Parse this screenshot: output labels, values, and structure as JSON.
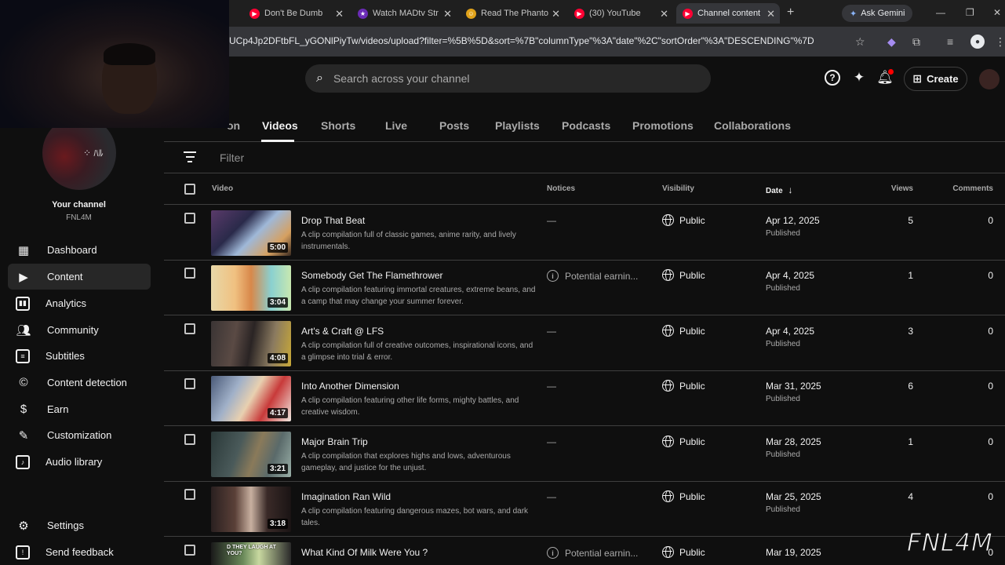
{
  "browser": {
    "tabs": [
      {
        "title": "Don't Be Dumb",
        "color": "#ff0033"
      },
      {
        "title": "Watch MADtv Str",
        "color": "#6a2bb5"
      },
      {
        "title": "Read The Phanto",
        "color": "#e0a21a"
      },
      {
        "title": "(30) YouTube",
        "color": "#ff0033"
      },
      {
        "title": "Channel content",
        "color": "#ff0033"
      }
    ],
    "ask_gemini": "Ask Gemini",
    "url": "UCp4Jp2DFtbFL_yGONlPiyTw/videos/upload?filter=%5B%5D&sort=%7B\"columnType\"%3A\"date\"%2C\"sortOrder\"%3A\"DESCENDING\"%7D"
  },
  "header": {
    "search_placeholder": "Search across your channel",
    "create_label": "Create"
  },
  "channel": {
    "label": "Your channel",
    "handle": "FNL4M"
  },
  "sidebar": {
    "items": [
      {
        "label": "Dashboard"
      },
      {
        "label": "Content"
      },
      {
        "label": "Analytics"
      },
      {
        "label": "Community"
      },
      {
        "label": "Subtitles"
      },
      {
        "label": "Content detection"
      },
      {
        "label": "Earn"
      },
      {
        "label": "Customization"
      },
      {
        "label": "Audio library"
      }
    ],
    "settings": "Settings",
    "feedback": "Send feedback"
  },
  "content_tabs": [
    "on",
    "Videos",
    "Shorts",
    "Live",
    "Posts",
    "Playlists",
    "Podcasts",
    "Promotions",
    "Collaborations"
  ],
  "filter_placeholder": "Filter",
  "columns": {
    "video": "Video",
    "notices": "Notices",
    "visibility": "Visibility",
    "date": "Date",
    "views": "Views",
    "comments": "Comments"
  },
  "videos": [
    {
      "title": "Drop That Beat",
      "desc": "A clip compilation full of classic games, anime rarity, and lively instrumentals.",
      "duration": "5:00",
      "notice": "—",
      "visibility": "Public",
      "date": "Apr 12, 2025",
      "status": "Published",
      "views": "5",
      "comments": "0"
    },
    {
      "title": "Somebody Get The Flamethrower",
      "desc": "A clip compilation featuring immortal creatures, extreme beans, and a camp that may change your summer forever.",
      "duration": "3:04",
      "notice": "Potential earnin...",
      "visibility": "Public",
      "date": "Apr 4, 2025",
      "status": "Published",
      "views": "1",
      "comments": "0"
    },
    {
      "title": "Art's & Craft @ LFS",
      "desc": "A clip compilation full of creative outcomes, inspirational icons, and a glimpse into trial & error.",
      "duration": "4:08",
      "notice": "—",
      "visibility": "Public",
      "date": "Apr 4, 2025",
      "status": "Published",
      "views": "3",
      "comments": "0"
    },
    {
      "title": "Into Another Dimension",
      "desc": "A clip compilation featuring other life forms, mighty battles, and creative wisdom.",
      "duration": "4:17",
      "notice": "—",
      "visibility": "Public",
      "date": "Mar 31, 2025",
      "status": "Published",
      "views": "6",
      "comments": "0"
    },
    {
      "title": "Major Brain Trip",
      "desc": "A clip compilation that explores highs and lows, adventurous gameplay, and justice for the unjust.",
      "duration": "3:21",
      "notice": "—",
      "visibility": "Public",
      "date": "Mar 28, 2025",
      "status": "Published",
      "views": "1",
      "comments": "0"
    },
    {
      "title": "Imagination Ran Wild",
      "desc": "A clip compilation featuring dangerous mazes, bot wars, and dark tales.",
      "duration": "3:18",
      "notice": "—",
      "visibility": "Public",
      "date": "Mar 25, 2025",
      "status": "Published",
      "views": "4",
      "comments": "0"
    },
    {
      "title": "What Kind Of Milk Were You ?",
      "desc": "",
      "duration": "",
      "caption": "D THEY LAUGH AT YOU?",
      "notice": "Potential earnin...",
      "visibility": "Public",
      "date": "Mar 19, 2025",
      "status": "",
      "views": "",
      "comments": "0"
    }
  ],
  "watermark": "FNL4M"
}
